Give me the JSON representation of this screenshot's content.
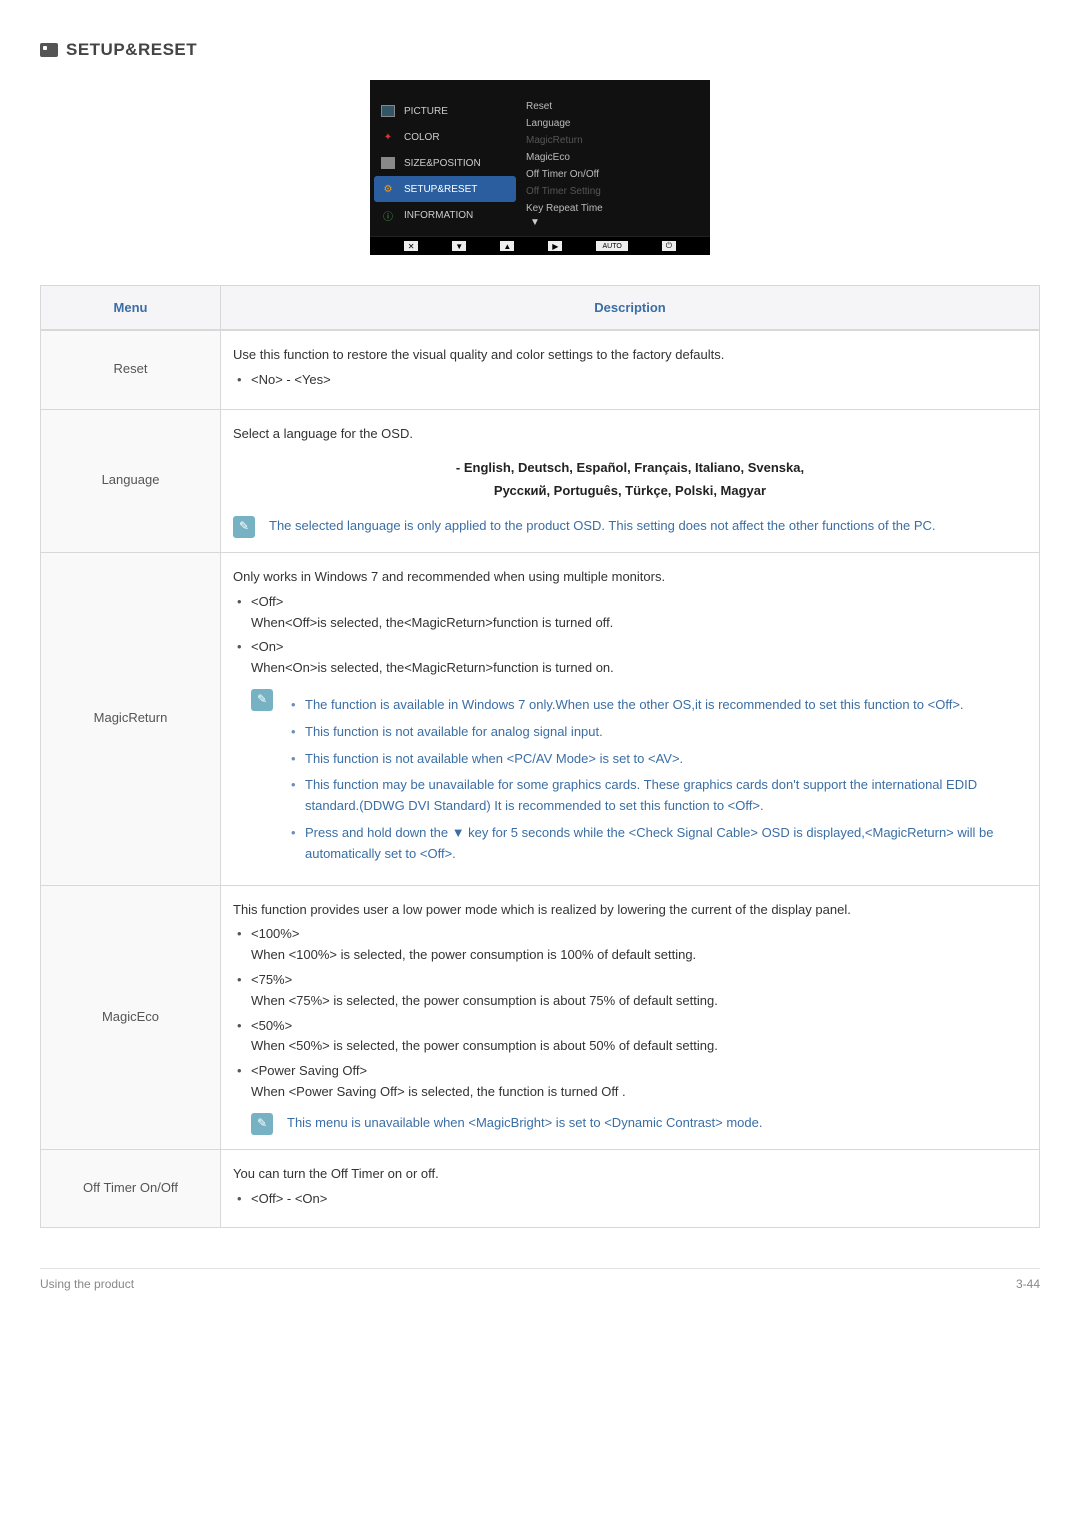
{
  "section": {
    "title": "SETUP&RESET"
  },
  "osd": {
    "left": {
      "picture": "PICTURE",
      "color": "COLOR",
      "sizepos": "SIZE&POSITION",
      "setupreset": "SETUP&RESET",
      "information": "INFORMATION"
    },
    "right": {
      "reset": "Reset",
      "language": "Language",
      "magicreturn": "MagicReturn",
      "magiceco": "MagicEco",
      "offtimer_onoff": "Off Timer On/Off",
      "offtimer_setting": "Off Timer Setting",
      "keyrepeat": "Key Repeat Time"
    },
    "footer": {
      "auto": "AUTO"
    }
  },
  "table": {
    "head": {
      "menu": "Menu",
      "desc": "Description"
    },
    "reset": {
      "label": "Reset",
      "desc": "Use this function to restore the visual quality and color settings to the factory defaults.",
      "opt": "<No> - <Yes>"
    },
    "language": {
      "label": "Language",
      "desc": "Select a language for the OSD.",
      "langs1": "- English, Deutsch, Español, Français, Italiano, Svenska,",
      "langs2": "Русский, Português, Türkçe, Polski, Magyar",
      "note": "The selected language is only applied to the product OSD. This setting does not affect the other functions of the PC."
    },
    "magicreturn": {
      "label": "MagicReturn",
      "intro": "Only works in Windows 7 and recommended when using multiple monitors.",
      "off_h": "<Off>",
      "off_t": "When<Off>is selected, the<MagicReturn>function is turned off.",
      "on_h": "<On>",
      "on_t": "When<On>is selected, the<MagicReturn>function is turned on.",
      "n1": "The function is available in Windows 7 only.When use the other OS,it is recommended to set this function to <Off>.",
      "n2": "This function is not available for analog signal input.",
      "n3": "This function is not available when <PC/AV Mode> is set to <AV>.",
      "n4": "This function may be unavailable for some graphics cards. These graphics cards don't support the international EDID standard.(DDWG DVI Standard) It is recommended to set this function to <Off>.",
      "n5": "Press and hold down the ▼ key for 5 seconds while the <Check Signal Cable> OSD is displayed,<MagicReturn> will be automatically set to <Off>."
    },
    "magiceco": {
      "label": "MagicEco",
      "intro": "This function provides user a low power mode which is realized by lowering the current of the display panel.",
      "p100_h": "<100%>",
      "p100_t": "When <100%> is selected, the power consumption is 100% of default setting.",
      "p75_h": "<75%>",
      "p75_t": "When <75%> is selected, the power consumption is about 75% of default setting.",
      "p50_h": "<50%>",
      "p50_t": "When <50%> is selected, the power consumption is about 50% of default setting.",
      "psoff_h": "<Power Saving Off>",
      "psoff_t": "When <Power Saving Off> is selected, the function is turned Off .",
      "note": "This menu is unavailable when <MagicBright> is set to <Dynamic Contrast> mode."
    },
    "offtimer": {
      "label": "Off Timer On/Off",
      "desc": "You can turn the Off Timer on or off.",
      "opt": "<Off> - <On>"
    }
  },
  "footer": {
    "left": "Using the product",
    "right": "3-44"
  }
}
